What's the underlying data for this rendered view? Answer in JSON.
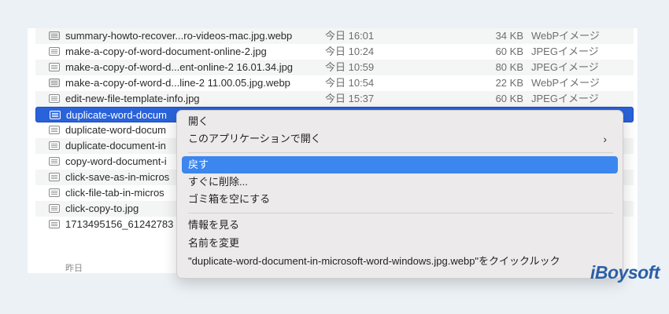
{
  "files": [
    {
      "name": "summary-howto-recover...ro-videos-mac.jpg.webp",
      "date": "今日 16:01",
      "size": "34 KB",
      "kind": "WebPイメージ",
      "icon": "webp-file-icon"
    },
    {
      "name": "make-a-copy-of-word-document-online-2.jpg",
      "date": "今日 10:24",
      "size": "60 KB",
      "kind": "JPEGイメージ",
      "icon": "image-file-icon"
    },
    {
      "name": "make-a-copy-of-word-d...ent-online-2 16.01.34.jpg",
      "date": "今日 10:59",
      "size": "80 KB",
      "kind": "JPEGイメージ",
      "icon": "image-file-icon"
    },
    {
      "name": "make-a-copy-of-word-d...line-2 11.00.05.jpg.webp",
      "date": "今日 10:54",
      "size": "22 KB",
      "kind": "WebPイメージ",
      "icon": "webp-file-icon"
    },
    {
      "name": "edit-new-file-template-info.jpg",
      "date": "今日 15:37",
      "size": "60 KB",
      "kind": "JPEGイメージ",
      "icon": "image-file-icon"
    },
    {
      "name": "duplicate-word-docum",
      "date": "",
      "size": "",
      "kind": "",
      "icon": "image-file-icon",
      "selected": true
    },
    {
      "name": "duplicate-word-docum",
      "date": "",
      "size": "",
      "kind": "",
      "icon": "image-file-icon"
    },
    {
      "name": "duplicate-document-in",
      "date": "",
      "size": "",
      "kind": "",
      "icon": "image-file-icon"
    },
    {
      "name": "copy-word-document-i",
      "date": "",
      "size": "",
      "kind": "",
      "icon": "image-file-icon"
    },
    {
      "name": "click-save-as-in-micros",
      "date": "",
      "size": "",
      "kind": "",
      "icon": "image-file-icon"
    },
    {
      "name": "click-file-tab-in-micros",
      "date": "",
      "size": "",
      "kind": "",
      "icon": "image-file-icon"
    },
    {
      "name": "click-copy-to.jpg",
      "date": "",
      "size": "",
      "kind": "",
      "icon": "image-file-icon"
    },
    {
      "name": "1713495156_61242783",
      "date": "",
      "size": "",
      "kind": "",
      "icon": "image-file-icon"
    }
  ],
  "group_label": "昨日",
  "context_menu": {
    "open": "開く",
    "open_with": "このアプリケーションで開く",
    "put_back": "戻す",
    "delete_immediately": "すぐに削除...",
    "empty_trash": "ゴミ箱を空にする",
    "get_info": "情報を見る",
    "rename": "名前を変更",
    "quick_look": "\"duplicate-word-document-in-microsoft-word-windows.jpg.webp\"をクイックルック",
    "highlighted_item": "put_back"
  },
  "brand": "iBoysoft",
  "colors": {
    "selection": "#2962d9",
    "menu_highlight": "#3c86f0",
    "brand": "#2b5fa6"
  }
}
